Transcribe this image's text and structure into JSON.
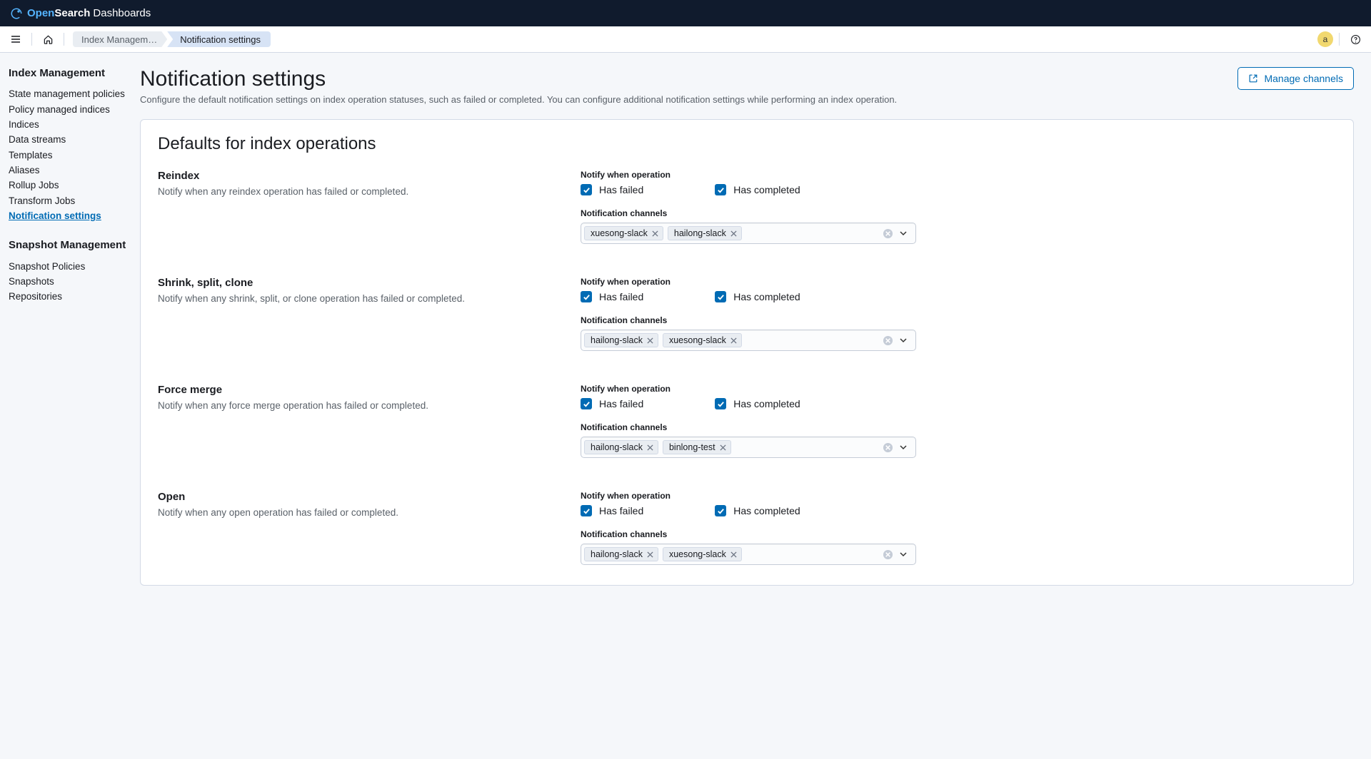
{
  "brand": {
    "open": "Open",
    "search": "Search",
    "dash": "Dashboards"
  },
  "breadcrumbs": [
    {
      "label": "Index Managem…"
    },
    {
      "label": "Notification settings"
    }
  ],
  "avatar_initial": "a",
  "sidebar": {
    "groups": [
      {
        "title": "Index Management",
        "items": [
          {
            "label": "State management policies"
          },
          {
            "label": "Policy managed indices"
          },
          {
            "label": "Indices"
          },
          {
            "label": "Data streams"
          },
          {
            "label": "Templates"
          },
          {
            "label": "Aliases"
          },
          {
            "label": "Rollup Jobs"
          },
          {
            "label": "Transform Jobs"
          },
          {
            "label": "Notification settings",
            "active": true
          }
        ]
      },
      {
        "title": "Snapshot Management",
        "items": [
          {
            "label": "Snapshot Policies"
          },
          {
            "label": "Snapshots"
          },
          {
            "label": "Repositories"
          }
        ]
      }
    ]
  },
  "page": {
    "title": "Notification settings",
    "description": "Configure the default notification settings on index operation statuses, such as failed or completed. You can configure additional notification settings while performing an index operation.",
    "manage_channels": "Manage channels",
    "panel_title": "Defaults for index operations"
  },
  "labels": {
    "notify_when": "Notify when operation",
    "has_failed": "Has failed",
    "has_completed": "Has completed",
    "channels": "Notification channels"
  },
  "ops": [
    {
      "title": "Reindex",
      "desc": "Notify when any reindex operation has failed or completed.",
      "channels": [
        "xuesong-slack",
        "hailong-slack"
      ]
    },
    {
      "title": "Shrink, split, clone",
      "desc": "Notify when any shrink, split, or clone operation has failed or completed.",
      "channels": [
        "hailong-slack",
        "xuesong-slack"
      ]
    },
    {
      "title": "Force merge",
      "desc": "Notify when any force merge operation has failed or completed.",
      "channels": [
        "hailong-slack",
        "binlong-test"
      ]
    },
    {
      "title": "Open",
      "desc": "Notify when any open operation has failed or completed.",
      "channels": [
        "hailong-slack",
        "xuesong-slack"
      ]
    }
  ]
}
